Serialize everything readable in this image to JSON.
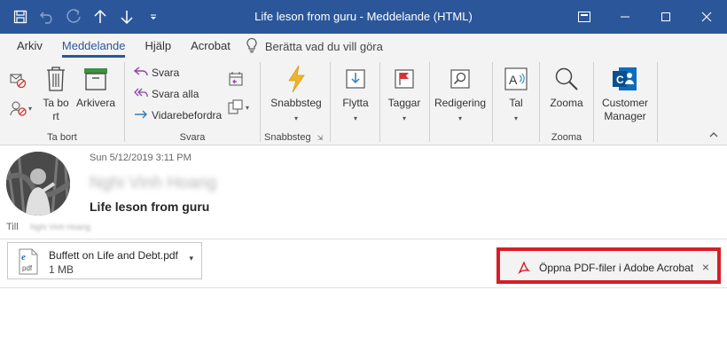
{
  "window": {
    "title": "Life leson from guru - Meddelande (HTML)"
  },
  "colors": {
    "titlebar": "#2b579a",
    "accent": "#2b579a",
    "highlight_box": "#d41f26"
  },
  "quick_access": [
    "save-icon",
    "undo-icon",
    "redo-icon",
    "up-arrow-icon",
    "down-arrow-icon",
    "customize-qat-icon"
  ],
  "window_controls": [
    "ribbon-display-icon",
    "minimize-icon",
    "maximize-icon",
    "close-icon"
  ],
  "tabs": [
    {
      "label": "Arkiv"
    },
    {
      "label": "Meddelande"
    },
    {
      "label": "Hjälp"
    },
    {
      "label": "Acrobat"
    }
  ],
  "active_tab": "Meddelande",
  "tell_me": "Berätta vad du vill göra",
  "ribbon": {
    "groups": {
      "delete": {
        "label": "Ta bort",
        "delete_button": "Ta bort",
        "archive_button": "Arkivera"
      },
      "respond": {
        "label": "Svara",
        "reply": "Svara",
        "reply_all": "Svara alla",
        "forward": "Vidarebefordra"
      },
      "quicksteps": {
        "label": "Snabbsteg",
        "button": "Snabbsteg"
      },
      "move": {
        "button": "Flytta"
      },
      "tags": {
        "button": "Taggar"
      },
      "editing": {
        "button": "Redigering"
      },
      "speech": {
        "button": "Tal"
      },
      "zoom": {
        "label": "Zooma",
        "button": "Zooma"
      },
      "addin": {
        "button_line1": "Customer",
        "button_line2": "Manager"
      }
    }
  },
  "message": {
    "date": "Sun 5/12/2019 3:11 PM",
    "sender": "Nghi Vinh Hoang",
    "subject": "Life leson from guru",
    "to_label": "Till",
    "to_value": "Nghi Vinh Hoang"
  },
  "attachment": {
    "name": "Buffett on Life and Debt.pdf",
    "size": "1 MB",
    "icon": "pdf-file-icon"
  },
  "notification": {
    "text": "Öppna PDF-filer i Adobe Acrobat",
    "icon": "adobe-acrobat-icon"
  }
}
